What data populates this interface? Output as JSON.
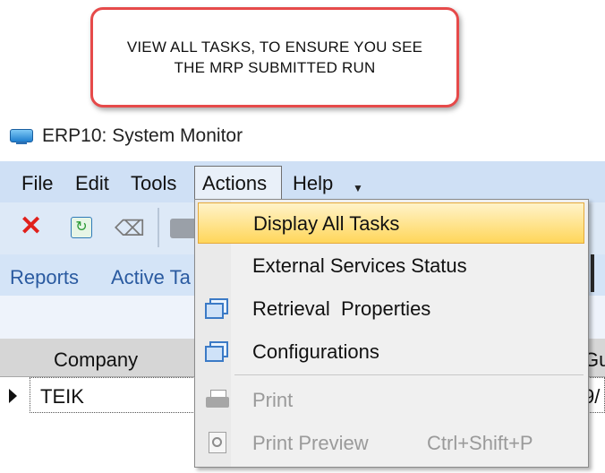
{
  "callout": {
    "text": "VIEW ALL TASKS, TO ENSURE YOU SEE THE MRP SUBMITTED RUN"
  },
  "window": {
    "title": "ERP10: System Monitor",
    "icon": "monitor-icon"
  },
  "menubar": {
    "file": "File",
    "edit": "Edit",
    "tools": "Tools",
    "actions": "Actions",
    "help": "Help",
    "overflow_icon": "chevron-down-icon"
  },
  "toolbar": {
    "icons": [
      "delete-icon",
      "refresh-icon",
      "eraser-icon",
      "print-icon"
    ]
  },
  "tabs": {
    "reports": "Reports",
    "active_tasks": "Active Ta"
  },
  "grid": {
    "columns": [
      "Company",
      "Gu"
    ],
    "rows": [
      {
        "company": "TEIK",
        "col2": "9/"
      }
    ]
  },
  "dropdown": {
    "items": [
      {
        "label": "Display All Tasks",
        "highlighted": true,
        "enabled": true,
        "icon": ""
      },
      {
        "label": "External Services Status",
        "enabled": true,
        "icon": ""
      },
      {
        "label": "Retrieval  Properties",
        "enabled": true,
        "icon": "window-icon"
      },
      {
        "label": "Configurations",
        "enabled": true,
        "icon": "window-icon"
      },
      {
        "label": "Print",
        "enabled": false,
        "icon": "print-icon"
      },
      {
        "label": "Print Preview",
        "shortcut": "Ctrl+Shift+P",
        "enabled": false,
        "icon": "print-preview-icon"
      }
    ]
  },
  "colors": {
    "callout_border": "#e64a4a",
    "menubar_bg": "#cfe0f5",
    "highlight": "#ffd65a",
    "delete_red": "#e0201b"
  }
}
